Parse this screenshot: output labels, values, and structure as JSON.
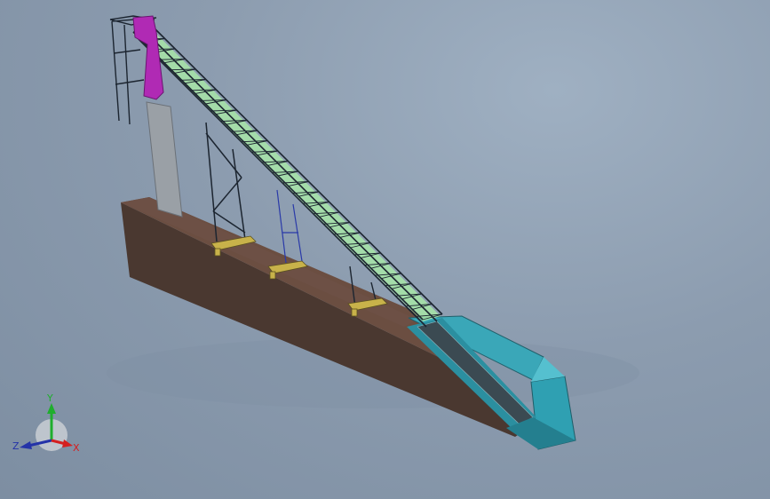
{
  "triad": {
    "y_label": "Y",
    "z_label": "Z",
    "x_label": "X",
    "colors": {
      "y": "#1fae2d",
      "z": "#2433a8",
      "x": "#d42020"
    }
  },
  "colors": {
    "background": "#8e9eb1",
    "soil_top": "#6b4e41",
    "soil_side": "#4a3830",
    "pit": "#3aa7b8",
    "pit_side": "#2b8fa0",
    "truss": "#1c2530",
    "belt": "#a8e6a8",
    "hopper": "#b02ab4",
    "footing": "#c8b24a",
    "column": "#9aa0a6"
  }
}
